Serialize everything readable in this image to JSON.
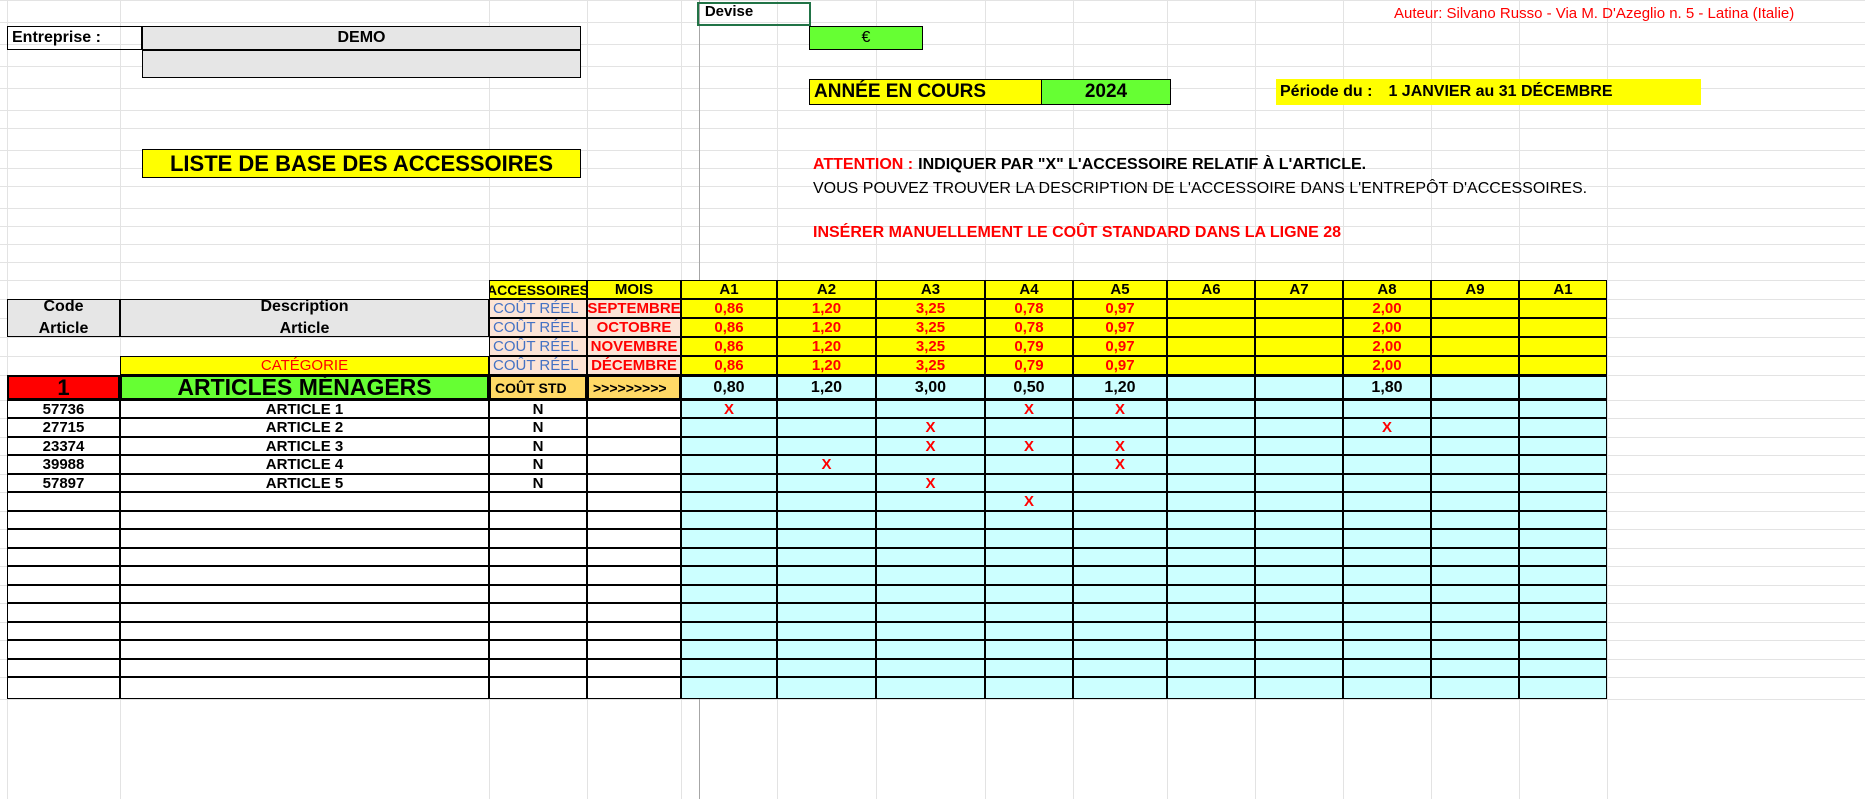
{
  "header": {
    "company_label": "Entreprise :",
    "company_name": "DEMO",
    "currency_label": "Devise",
    "currency_value": "€",
    "author": "Auteur: Silvano Russo - Via M. D'Azeglio n. 5 - Latina (Italie)",
    "year_label": "ANNÉE EN COURS",
    "year_value": "2024",
    "period_label": "Période du :",
    "period_value": "1 JANVIER au 31 DÉCEMBRE",
    "list_title": "LISTE DE BASE DES ACCESSOIRES"
  },
  "notes": {
    "attention_prefix": "ATTENTION :",
    "attention_text": "INDIQUER PAR \"X\" L'ACCESSOIRE RELATIF À L'ARTICLE.",
    "info_text": "VOUS POUVEZ TROUVER LA DESCRIPTION DE L'ACCESSOIRE DANS L'ENTREPÔT D'ACCESSOIRES.",
    "insert_text": "INSÉRER MANUELLEMENT LE COÛT STANDARD DANS LA LIGNE 28",
    "accessories_tag": "ACCESSOIRES"
  },
  "table": {
    "col_accessoires": "ACCESSOIRES",
    "col_mois": "MOIS",
    "code_label_1": "Code",
    "code_label_2": "Article",
    "desc_label_1": "Description",
    "desc_label_2": "Article",
    "category_label": "CATÉGORIE",
    "category_number": "1",
    "category_name": "ARTICLES MÉNAGERS",
    "std_label": "COÛT STD",
    "std_arrow": ">>>>>>>>>",
    "accessory_columns": [
      "A1",
      "A2",
      "A3",
      "A4",
      "A5",
      "A6",
      "A7",
      "A8",
      "A9",
      "A1"
    ],
    "real_cost_rows": [
      {
        "label": "COÛT RÉEL",
        "month": "SEPTEMBRE",
        "values": [
          "0,86",
          "1,20",
          "3,25",
          "0,78",
          "0,97",
          "",
          "",
          "2,00",
          "",
          ""
        ]
      },
      {
        "label": "COÛT RÉEL",
        "month": "OCTOBRE",
        "values": [
          "0,86",
          "1,20",
          "3,25",
          "0,78",
          "0,97",
          "",
          "",
          "2,00",
          "",
          ""
        ]
      },
      {
        "label": "COÛT RÉEL",
        "month": "NOVEMBRE",
        "values": [
          "0,86",
          "1,20",
          "3,25",
          "0,79",
          "0,97",
          "",
          "",
          "2,00",
          "",
          ""
        ]
      },
      {
        "label": "COÛT RÉEL",
        "month": "DÉCEMBRE",
        "values": [
          "0,86",
          "1,20",
          "3,25",
          "0,79",
          "0,97",
          "",
          "",
          "2,00",
          "",
          ""
        ]
      }
    ],
    "std_values": [
      "0,80",
      "1,20",
      "3,00",
      "0,50",
      "1,20",
      "",
      "",
      "1,80",
      "",
      ""
    ],
    "articles": [
      {
        "code": "57736",
        "name": "ARTICLE 1",
        "flag": "N",
        "marks": [
          "X",
          "",
          "",
          "X",
          "X",
          "",
          "",
          "",
          "",
          ""
        ]
      },
      {
        "code": "27715",
        "name": "ARTICLE 2",
        "flag": "N",
        "marks": [
          "",
          "",
          "X",
          "",
          "",
          "",
          "",
          "X",
          "",
          ""
        ]
      },
      {
        "code": "23374",
        "name": "ARTICLE 3",
        "flag": "N",
        "marks": [
          "",
          "",
          "X",
          "X",
          "X",
          "",
          "",
          "",
          "",
          ""
        ]
      },
      {
        "code": "39988",
        "name": "ARTICLE 4",
        "flag": "N",
        "marks": [
          "",
          "X",
          "",
          "",
          "X",
          "",
          "",
          "",
          "",
          ""
        ]
      },
      {
        "code": "57897",
        "name": "ARTICLE 5",
        "flag": "N",
        "marks": [
          "",
          "",
          "X",
          "",
          "",
          "",
          "",
          "",
          "",
          ""
        ]
      },
      {
        "code": "",
        "name": "",
        "flag": "",
        "marks": [
          "",
          "",
          "",
          "X",
          "",
          "",
          "",
          "",
          "",
          ""
        ]
      }
    ],
    "empty_row_count": 9
  }
}
